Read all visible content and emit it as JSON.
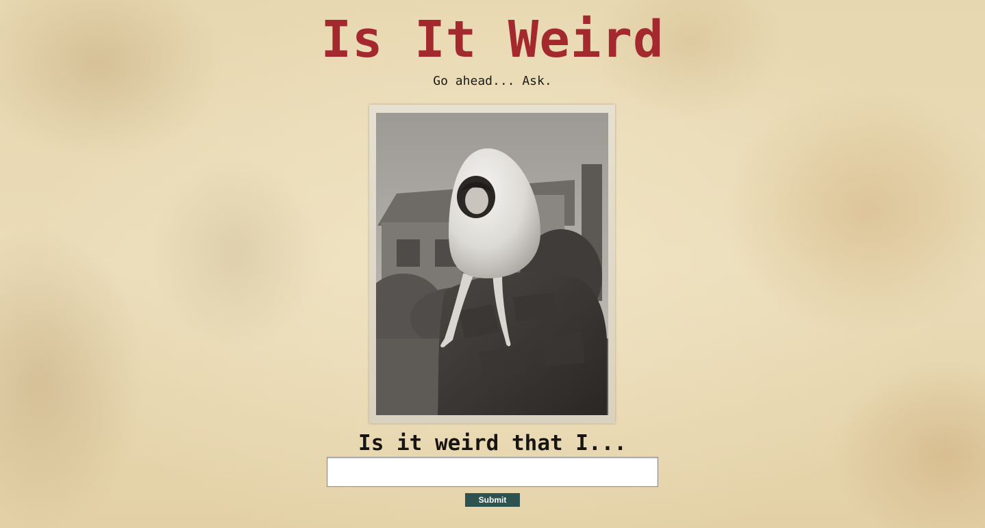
{
  "header": {
    "title": "Is It Weird",
    "tagline": "Go ahead... Ask."
  },
  "photo": {
    "subject": "vintage-photo-woman-in-egg-costume"
  },
  "form": {
    "question_label": "Is it weird that I...",
    "input_value": "",
    "input_placeholder": "",
    "submit_label": "Submit"
  },
  "colors": {
    "title": "#a4292e",
    "submit_button": "#2e5250",
    "text": "#1c1a17"
  }
}
